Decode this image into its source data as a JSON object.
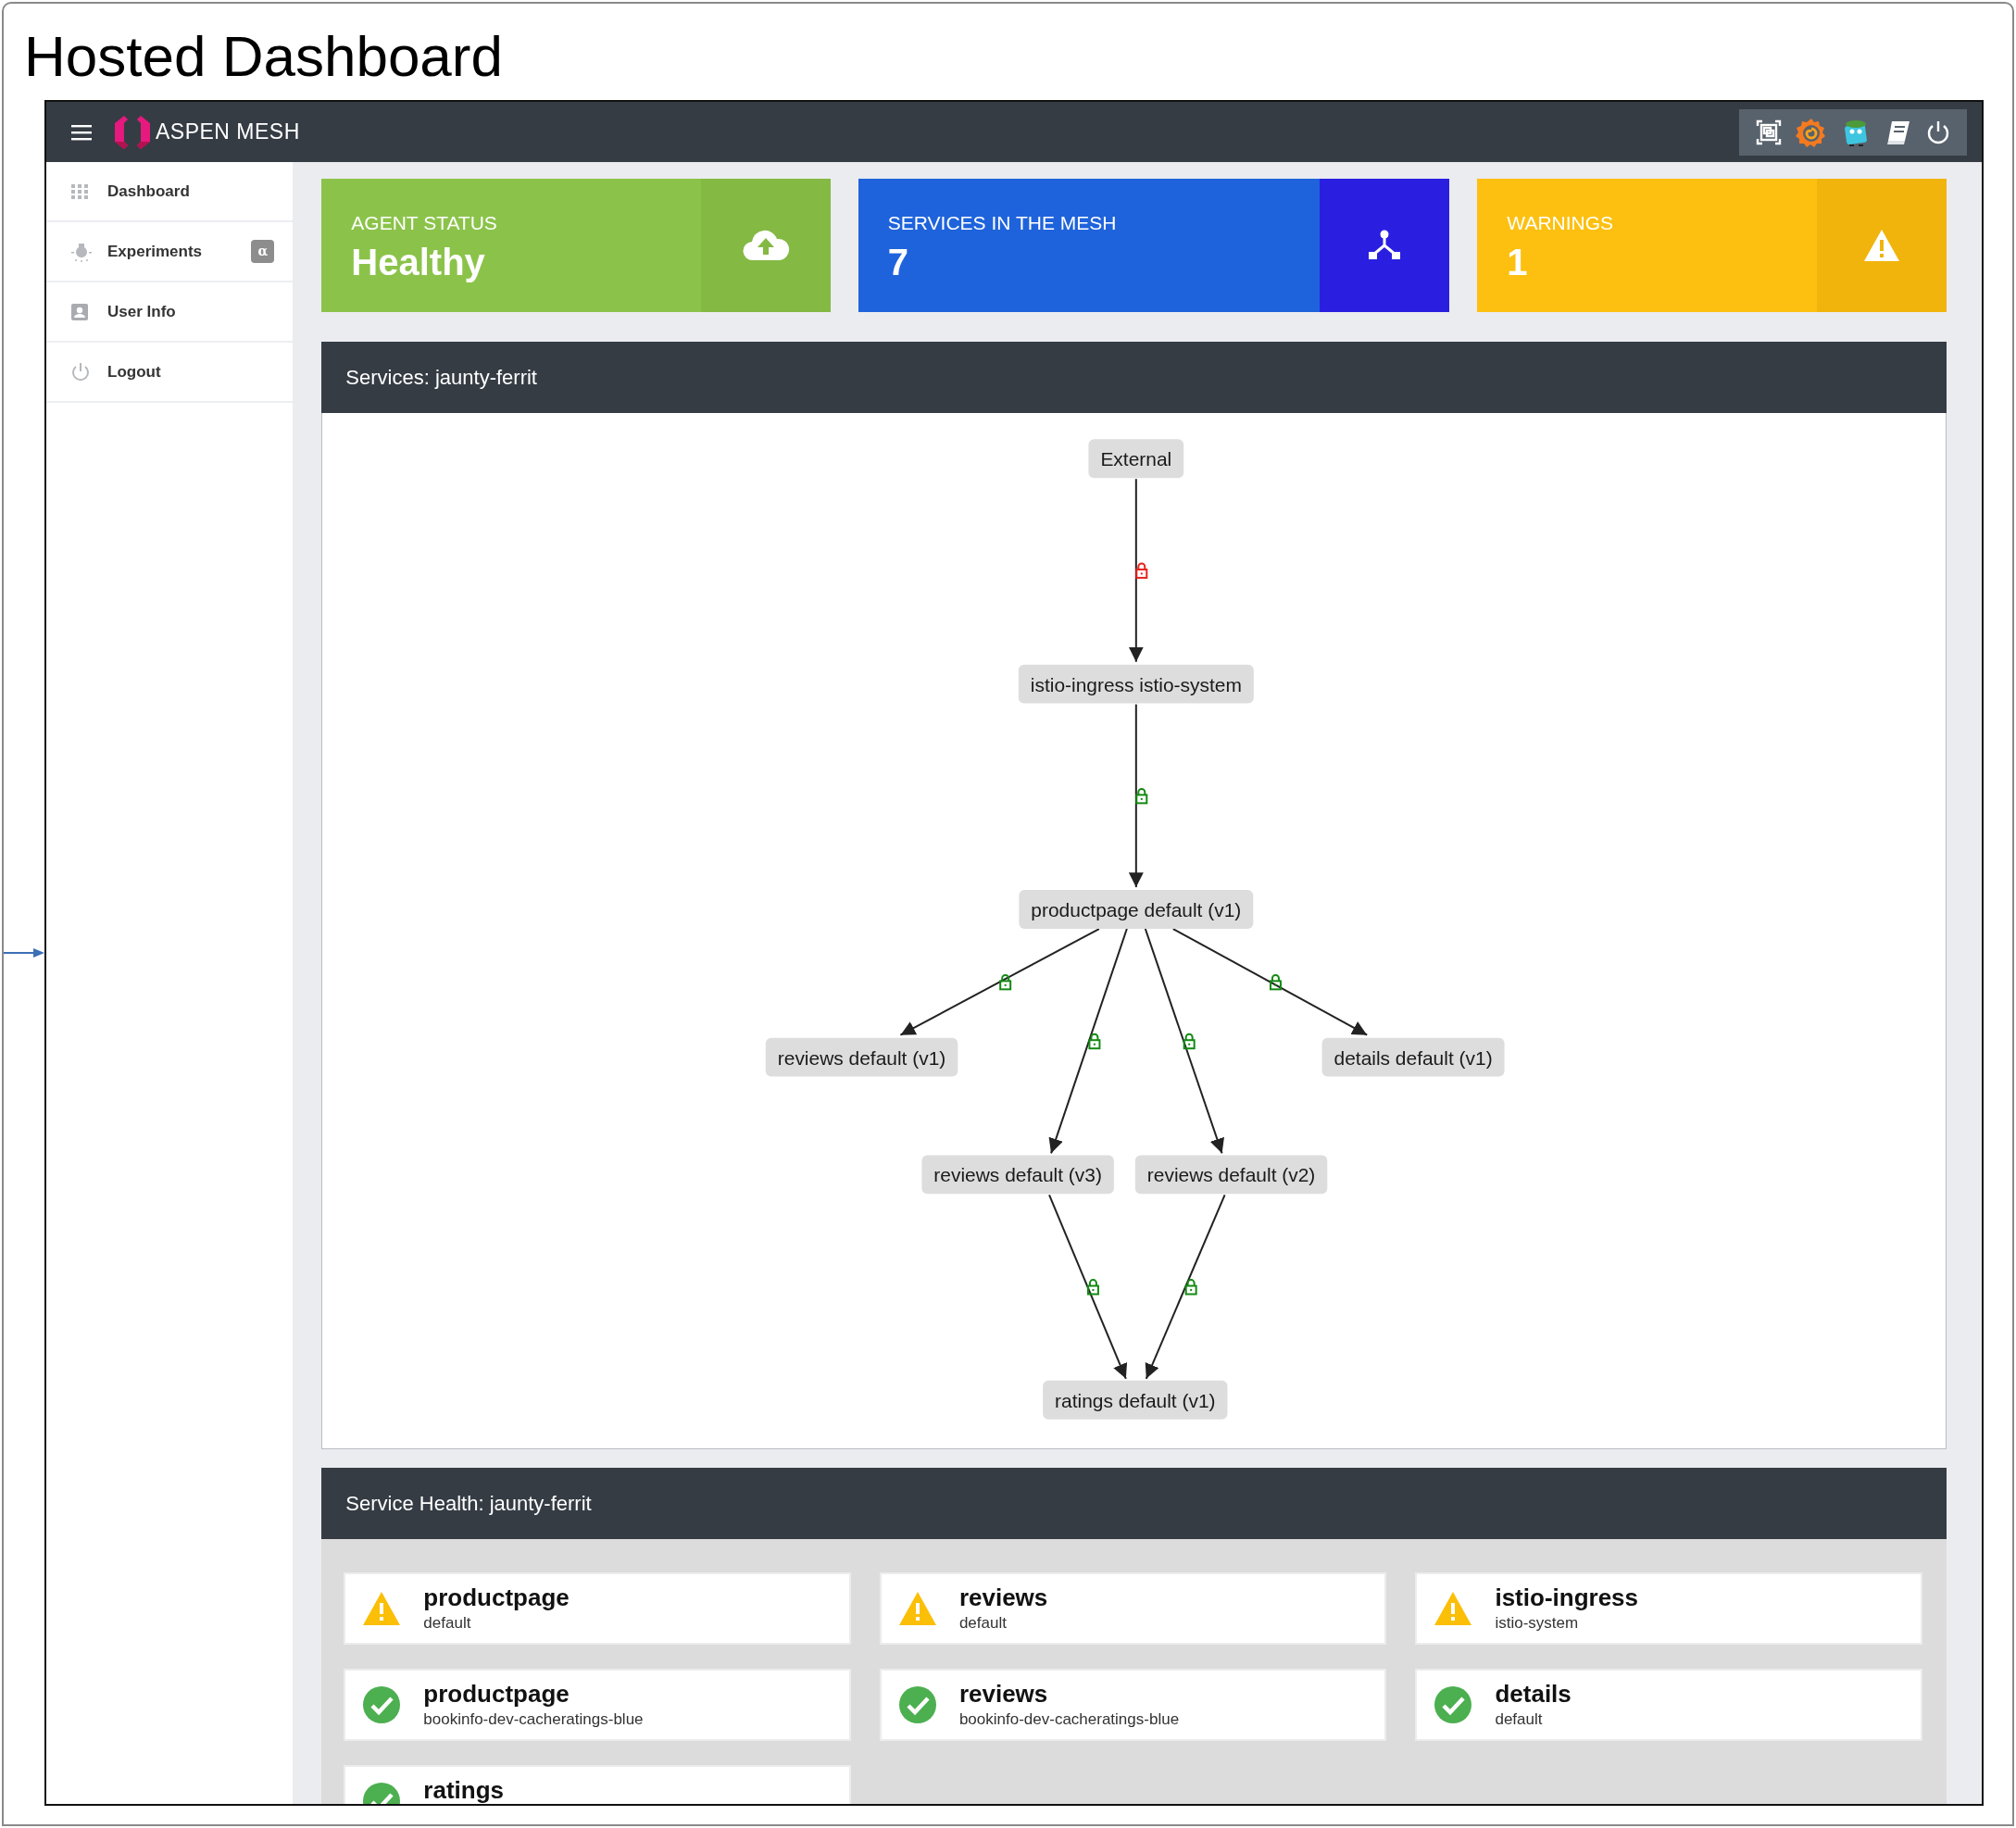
{
  "page_title": "Hosted Dashboard",
  "topbar": {
    "brand": "ASPEN MESH"
  },
  "sidebar": {
    "items": [
      {
        "label": "Dashboard"
      },
      {
        "label": "Experiments",
        "badge": "α"
      },
      {
        "label": "User Info"
      },
      {
        "label": "Logout"
      }
    ]
  },
  "stats": [
    {
      "kind": "agent",
      "label": "AGENT STATUS",
      "value": "Healthy",
      "color": "#8bc34a"
    },
    {
      "kind": "services",
      "label": "SERVICES IN THE MESH",
      "value": "7",
      "color": "#1e63dc"
    },
    {
      "kind": "warnings",
      "label": "WARNINGS",
      "value": "1",
      "color": "#fdc010"
    }
  ],
  "graph": {
    "title": "Services: jaunty-ferrit",
    "nodes": [
      {
        "label": "External"
      },
      {
        "label": "istio-ingress istio-system"
      },
      {
        "label": "productpage default (v1)"
      },
      {
        "label": "reviews default (v1)"
      },
      {
        "label": "details default (v1)"
      },
      {
        "label": "reviews default (v3)"
      },
      {
        "label": "reviews default (v2)"
      },
      {
        "label": "ratings default (v1)"
      }
    ],
    "edges": [
      {
        "secure": false
      },
      {
        "secure": true
      },
      {
        "secure": true
      },
      {
        "secure": true
      },
      {
        "secure": true
      },
      {
        "secure": true
      },
      {
        "secure": true
      },
      {
        "secure": true
      }
    ]
  },
  "health": {
    "title": "Service Health: jaunty-ferrit",
    "services": [
      {
        "name": "productpage",
        "namespace": "default",
        "healthy": false
      },
      {
        "name": "reviews",
        "namespace": "default",
        "healthy": false
      },
      {
        "name": "istio-ingress",
        "namespace": "istio-system",
        "healthy": false
      },
      {
        "name": "productpage",
        "namespace": "bookinfo-dev-cacheratings-blue",
        "healthy": true
      },
      {
        "name": "reviews",
        "namespace": "bookinfo-dev-cacheratings-blue",
        "healthy": true
      },
      {
        "name": "details",
        "namespace": "default",
        "healthy": true
      },
      {
        "name": "ratings",
        "healthy": true
      }
    ]
  }
}
